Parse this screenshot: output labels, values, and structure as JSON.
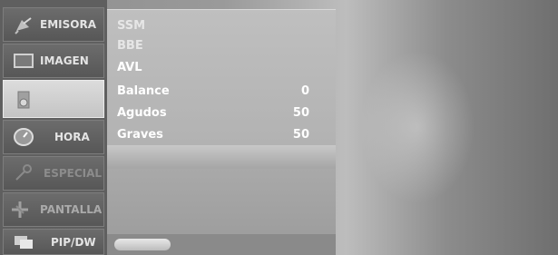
{
  "menu": {
    "items": [
      {
        "label": "EMISORA",
        "icon": "satellite-dish-icon"
      },
      {
        "label": "IMAGEN",
        "icon": "monitor-icon"
      },
      {
        "label": "",
        "icon": "speaker-icon",
        "selected": true
      },
      {
        "label": "HORA",
        "icon": "clock-icon"
      },
      {
        "label": "ESPECIAL",
        "icon": "key-icon"
      },
      {
        "label": "PANTALLA",
        "icon": "crosshair-icon"
      },
      {
        "label": "PIP/DW",
        "icon": "pip-windows-icon"
      }
    ]
  },
  "submenu": {
    "rows": [
      {
        "name": "SSM",
        "value": ""
      },
      {
        "name": "BBE",
        "value": ""
      },
      {
        "name": "AVL",
        "value": ""
      },
      {
        "name": "Balance",
        "value": "0"
      },
      {
        "name": "Agudos",
        "value": "50"
      },
      {
        "name": "Graves",
        "value": "50"
      }
    ]
  },
  "colors": {
    "panel": "#b8b8b8",
    "menu_bg": "#5f5f5f",
    "selected": "#d0d0d0"
  }
}
